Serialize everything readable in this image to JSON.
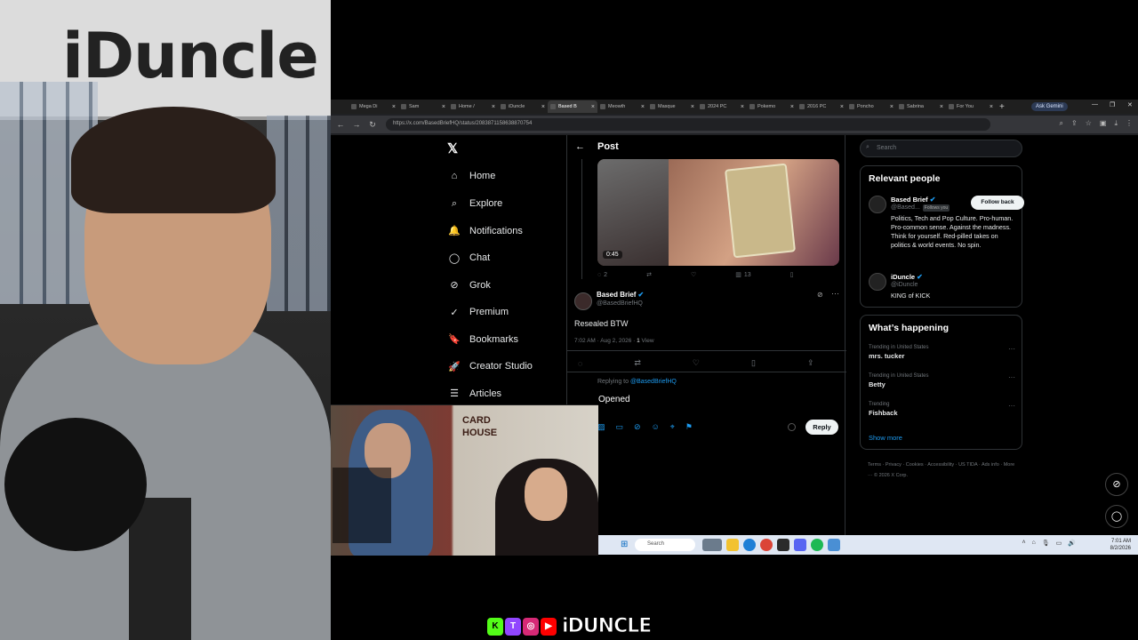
{
  "stream": {
    "wall_sign": "iDuncle",
    "brand_word": "iDUNCLE",
    "pip_sign": "CARD\nHOUSE",
    "social_icons": [
      "kick-icon",
      "twitch-icon",
      "instagram-icon",
      "youtube-icon"
    ]
  },
  "browser": {
    "tabs": [
      {
        "label": "Mega Di",
        "active": false
      },
      {
        "label": "Sam",
        "active": false
      },
      {
        "label": "Home /",
        "active": false
      },
      {
        "label": "iDuncle",
        "active": false
      },
      {
        "label": "Based B",
        "active": true
      },
      {
        "label": "Meowth",
        "active": false
      },
      {
        "label": "Masque",
        "active": false
      },
      {
        "label": "2024 PC",
        "active": false
      },
      {
        "label": "Pokemo",
        "active": false
      },
      {
        "label": "2016 PC",
        "active": false
      },
      {
        "label": "Poncho",
        "active": false
      },
      {
        "label": "Sabrina",
        "active": false
      },
      {
        "label": "For You",
        "active": false
      }
    ],
    "ask_gemini": "Ask Gemini",
    "url": "https://x.com/BasedBriefHQ/status/2083871158638870754"
  },
  "x_nav": {
    "items": [
      {
        "icon": "home-icon",
        "glyph": "⌂",
        "label": "Home"
      },
      {
        "icon": "explore-icon",
        "glyph": "⌕",
        "label": "Explore"
      },
      {
        "icon": "bell-icon",
        "glyph": "🔔",
        "label": "Notifications"
      },
      {
        "icon": "chat-icon",
        "glyph": "◯",
        "label": "Chat"
      },
      {
        "icon": "grok-icon",
        "glyph": "⊘",
        "label": "Grok"
      },
      {
        "icon": "premium-icon",
        "glyph": "✓",
        "label": "Premium"
      },
      {
        "icon": "bookmark-icon",
        "glyph": "🔖",
        "label": "Bookmarks"
      },
      {
        "icon": "creator-studio-icon",
        "glyph": "🚀",
        "label": "Creator Studio"
      },
      {
        "icon": "articles-icon",
        "glyph": "☰",
        "label": "Articles"
      }
    ]
  },
  "post": {
    "header_title": "Post",
    "video_duration": "0:45",
    "quoted_actions": {
      "replies": "2",
      "views": "13"
    },
    "author_name": "Based Brief",
    "author_handle": "@BasedBriefHQ",
    "text": "Resealed BTW",
    "timestamp": "7:02 AM · Aug 2, 2026 ·",
    "views_count": "1",
    "views_label": "View",
    "replying_prefix": "Replying to",
    "replying_handle": "@BasedBriefHQ",
    "reply_draft": "Opened",
    "reply_button": "Reply"
  },
  "right": {
    "search_placeholder": "Search",
    "relevant_title": "Relevant people",
    "people": [
      {
        "name": "Based Brief",
        "handle": "@Based...",
        "follows_you": "Follows you",
        "follow_label": "Follow back",
        "bio": "Politics, Tech and Pop Culture. Pro-human. Pro-common sense. Against the madness. Think for yourself. Red-pilled takes on politics & world events. No spin."
      },
      {
        "name": "iDuncle",
        "handle": "@iDuncle",
        "bio": "KING of KICK"
      }
    ],
    "happening_title": "What’s happening",
    "trends": [
      {
        "context": "Trending in United States",
        "title": "mrs. tucker"
      },
      {
        "context": "Trending in United States",
        "title": "Betty"
      },
      {
        "context": "Trending",
        "title": "Fishback"
      }
    ],
    "show_more": "Show more",
    "footer": "Terms · Privacy · Cookies · Accessibility · US TIDA · Ads info · More ··· © 2026 X Corp."
  },
  "taskbar": {
    "search": "Search",
    "time": "7:01 AM",
    "date": "8/2/2026"
  },
  "colors": {
    "accent": "#1d9bf0",
    "background": "#000000",
    "border": "#2f3336"
  }
}
